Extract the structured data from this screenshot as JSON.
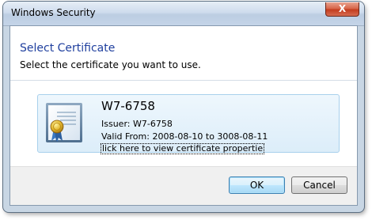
{
  "window": {
    "title": "Windows Security",
    "close_glyph": "X"
  },
  "dialog": {
    "heading": "Select Certificate",
    "subheading": "Select the certificate you want to use."
  },
  "certificate": {
    "name": "W7-6758",
    "issuer": "Issuer: W7-6758",
    "valid": "Valid From: 2008-08-10 to 3008-08-11",
    "link": "lick here to view certificate propertie",
    "icon": "certificate-icon"
  },
  "buttons": {
    "ok": "OK",
    "cancel": "Cancel"
  },
  "colors": {
    "heading": "#1f3f9e",
    "tile_border": "#a8d0ec",
    "close_button": "#c33d1f"
  }
}
